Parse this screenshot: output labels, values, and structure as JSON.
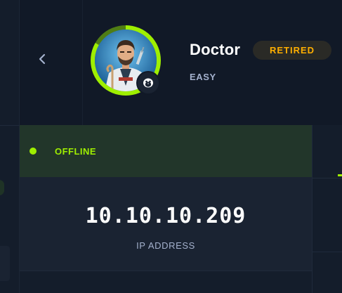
{
  "machine": {
    "name": "Doctor",
    "status_badge": "RETIRED",
    "difficulty": "EASY"
  },
  "connection": {
    "status": "OFFLINE",
    "ip_address": "10.10.10.209",
    "ip_label": "IP ADDRESS"
  },
  "icons": {
    "back": "chevron-left-icon",
    "os": "linux-penguin-icon",
    "status": "status-dot-icon"
  },
  "colors": {
    "accent_green": "#9fef00",
    "retired_orange": "#ffaf00",
    "background": "#111927",
    "card": "#1a2332",
    "status_bar": "#22362a",
    "muted_text": "#a4b1cd"
  }
}
